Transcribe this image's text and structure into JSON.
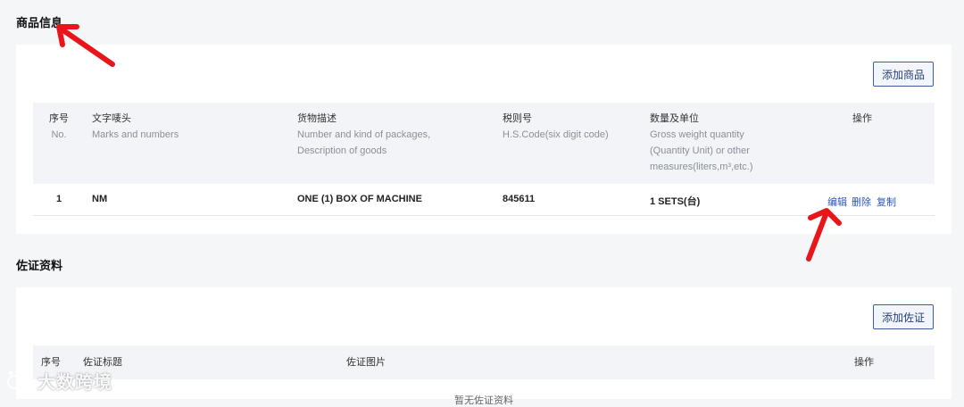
{
  "goods_section": {
    "title": "商品信息",
    "add_button": "添加商品",
    "columns": [
      {
        "zh": "序号",
        "en": "No."
      },
      {
        "zh": "文字唛头",
        "en": "Marks and numbers"
      },
      {
        "zh": "货物描述",
        "en": "Number and kind of packages,\nDescription of goods"
      },
      {
        "zh": "税则号",
        "en": "H.S.Code(six digit code)"
      },
      {
        "zh": "数量及单位",
        "en": "Gross weight quantity\n(Quantity Unit) or other\nmeasures(liters,m³,etc.)"
      },
      {
        "zh": "操作",
        "en": ""
      }
    ],
    "rows": [
      {
        "no": "1",
        "marks": "NM",
        "description": "ONE (1) BOX OF MACHINE",
        "hs_code": "845611",
        "quantity": "1 SETS(台)"
      }
    ],
    "actions": {
      "edit": "编辑",
      "delete": "删除",
      "copy": "复制"
    }
  },
  "docs_section": {
    "title": "佐证资料",
    "add_button": "添加佐证",
    "columns": [
      "序号",
      "佐证标题",
      "佐证图片",
      "操作"
    ],
    "empty_text": "暂无佐证资料"
  },
  "annotations": {
    "arrow_color": "#e8161b"
  },
  "watermark": {
    "text": "大数跨境",
    "logo": "paw-logo-icon"
  }
}
